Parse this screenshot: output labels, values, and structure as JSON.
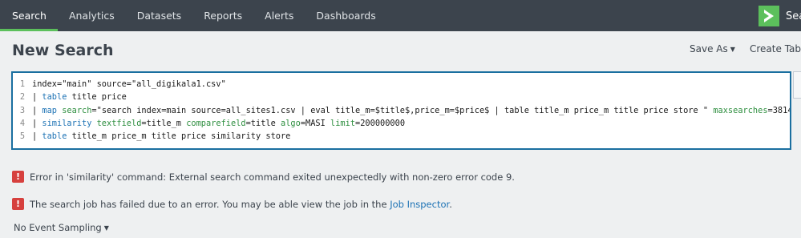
{
  "nav": {
    "items": [
      {
        "label": "Search",
        "active": true
      },
      {
        "label": "Analytics"
      },
      {
        "label": "Datasets"
      },
      {
        "label": "Reports"
      },
      {
        "label": "Alerts"
      },
      {
        "label": "Dashboards"
      }
    ],
    "logo_glyph": ">",
    "logo_text_partial": "Sea"
  },
  "header": {
    "title": "New Search",
    "save_as": "Save As",
    "create_table": "Create Table"
  },
  "editor": {
    "line_numbers": [
      "1",
      "2",
      "3",
      "4",
      "5"
    ],
    "lines": [
      [
        {
          "t": "index=\"main\" source=\"all_digikala1.csv\""
        }
      ],
      [
        {
          "t": "| "
        },
        {
          "t": "table",
          "c": "kw"
        },
        {
          "t": " title price"
        }
      ],
      [
        {
          "t": "| "
        },
        {
          "t": "map",
          "c": "kw"
        },
        {
          "t": " "
        },
        {
          "t": "search",
          "c": "arg"
        },
        {
          "t": "=\"search index=main source=all_sites1.csv | eval title_m=$title$,price_m=$price$ | table title_m price_m title price store \" "
        },
        {
          "t": "maxsearches",
          "c": "arg"
        },
        {
          "t": "=3814"
        }
      ],
      [
        {
          "t": "| "
        },
        {
          "t": "similarity",
          "c": "kw"
        },
        {
          "t": " "
        },
        {
          "t": "textfield",
          "c": "arg"
        },
        {
          "t": "=title_m "
        },
        {
          "t": "comparefield",
          "c": "arg"
        },
        {
          "t": "=title "
        },
        {
          "t": "algo",
          "c": "arg"
        },
        {
          "t": "=MASI "
        },
        {
          "t": "limit",
          "c": "arg"
        },
        {
          "t": "=200000000"
        }
      ],
      [
        {
          "t": "| "
        },
        {
          "t": "table",
          "c": "kw"
        },
        {
          "t": " title_m price_m title price similarity store"
        }
      ]
    ]
  },
  "messages": {
    "error1": "Error in 'similarity' command: External search command exited unexpectedly with non-zero error code 9.",
    "error2_prefix": "The search job has failed due to an error. You may be able view the job in the ",
    "error2_link": "Job Inspector",
    "error2_suffix": ".",
    "error_icon_glyph": "!"
  },
  "footer": {
    "sampling": "No Event Sampling"
  },
  "colors": {
    "nav_bg": "#3c444d",
    "accent_green": "#5cc05c",
    "editor_border": "#1a6fa0",
    "error_red": "#d6403e",
    "link_blue": "#1e73b5"
  },
  "icons": {
    "caret": "caret-down-icon",
    "error": "error-icon",
    "logo": "splunk-logo-icon"
  }
}
